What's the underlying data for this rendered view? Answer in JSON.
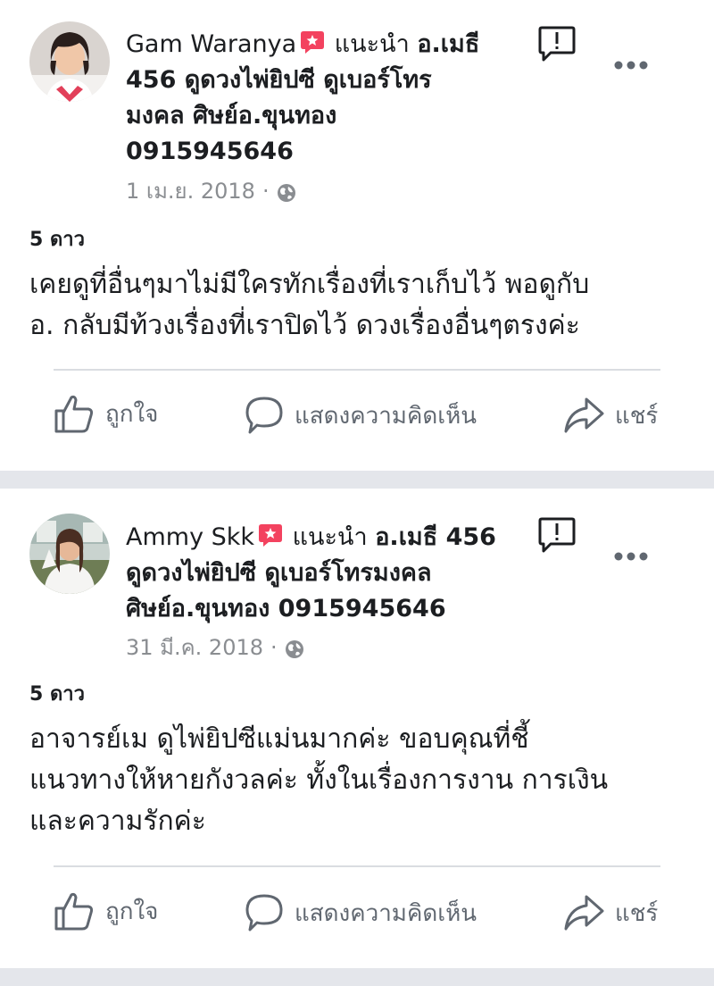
{
  "colors": {
    "text": "#1c1e21",
    "secondary": "#8a8d91",
    "action": "#606770",
    "badge": "#f3425f",
    "separator": "#e4e6eb"
  },
  "icons": {
    "recommend": "recommend-badge-icon",
    "globe": "globe-icon",
    "report": "report-icon",
    "more": "more-icon",
    "like": "like-icon",
    "comment": "comment-icon",
    "share": "share-icon"
  },
  "reviews": [
    {
      "author": "Gam Waranya",
      "recommends_label": "แนะนำ",
      "page_name_line1": "อ.เมธี",
      "page_name_line2": "456 ดูดวงไพ่ยิปซี ดูเบอร์โทร",
      "page_name_line3": "มงคล ศิษย์อ.ขุนทอง",
      "page_name_line4": "0915945646",
      "date": "1 เม.ย. 2018",
      "separator": "·",
      "rating": "5 ดาว",
      "text_line1": "เคยดูที่อื่นๆมาไม่มีใครทักเรื่องที่เราเก็บไว้ พอดูกับ",
      "text_line2": "อ. กลับมีท้วงเรื่องที่เราปิดไว้ ดวงเรื่องอื่นๆตรงค่ะ"
    },
    {
      "author": "Ammy Skk",
      "recommends_label": "แนะนำ",
      "page_name_line1": "อ.เมธี 456",
      "page_name_line2": "ดูดวงไพ่ยิปซี ดูเบอร์โทรมงคล",
      "page_name_line3": "ศิษย์อ.ขุนทอง 0915945646",
      "date": "31 มี.ค. 2018",
      "separator": "·",
      "rating": "5 ดาว",
      "text_line1": "อาจารย์เม ดูไพ่ยิปซีแม่นมากค่ะ ขอบคุณที่ชี้",
      "text_line2": "แนวทางให้หายกังวลค่ะ ทั้งในเรื่องการงาน การเงิน",
      "text_line3": "และความรักค่ะ"
    }
  ],
  "actions": {
    "like": "ถูกใจ",
    "comment": "แสดงความคิดเห็น",
    "share": "แชร์"
  }
}
